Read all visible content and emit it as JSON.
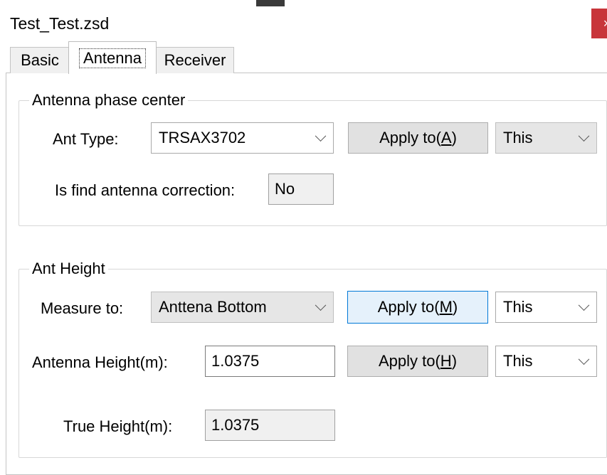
{
  "window": {
    "title": "Test_Test.zsd",
    "close_glyph": "×"
  },
  "tabs": [
    {
      "label": "Basic"
    },
    {
      "label": "Antenna"
    },
    {
      "label": "Receiver"
    }
  ],
  "active_tab": "Antenna",
  "phase_center": {
    "legend": "Antenna phase center",
    "ant_type_label": "Ant Type:",
    "ant_type_value": "TRSAX3702",
    "apply_prefix": "Apply to(",
    "apply_key": "A",
    "apply_suffix": ")",
    "scope_value": "This",
    "correction_label": "Is find antenna correction:",
    "correction_value": "No"
  },
  "ant_height": {
    "legend": "Ant Height",
    "measure_label": "Measure to:",
    "measure_value": "Anttena Bottom",
    "measure_apply_prefix": "Apply to(",
    "measure_apply_key": "M",
    "measure_apply_suffix": ")",
    "measure_scope_value": "This",
    "height_label": "Antenna Height(m):",
    "height_value": "1.0375",
    "height_apply_prefix": "Apply to(",
    "height_apply_key": "H",
    "height_apply_suffix": ")",
    "height_scope_value": "This",
    "true_height_label": "True Height(m):",
    "true_height_value": "1.0375"
  }
}
